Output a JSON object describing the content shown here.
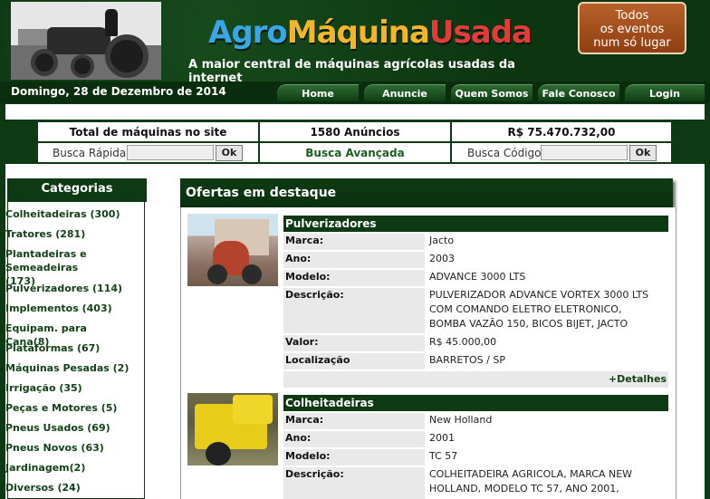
{
  "header": {
    "logo_part1": "Agro",
    "logo_part2": "Máquina",
    "logo_part3": "Usada",
    "tagline": "A maior central de máquinas agrícolas usadas da internet",
    "promo_line1": "Todos",
    "promo_line2": "os eventos",
    "promo_line3": "num só lugar"
  },
  "nav": {
    "date": "Domingo, 28 de Dezembro de 2014",
    "tabs": [
      "Home",
      "Anuncie",
      "Quem Somos",
      "Fale Conosco",
      "Login"
    ]
  },
  "stats": {
    "total_label": "Total de máquinas no site",
    "ads_count": "1580 Anúncios",
    "total_value": "R$ 75.470.732,00"
  },
  "search": {
    "quick_label": "Busca Rápida",
    "quick_value": "",
    "ok1": "Ok",
    "advanced_label": "Busca Avançada",
    "code_label": "Busca Código",
    "code_value": "",
    "ok2": "Ok"
  },
  "sidebar": {
    "title": "Categorias",
    "items": [
      "Colheitadeiras (300)",
      "Tratores (281)",
      "Plantadeiras e Semeadeiras (173)",
      "Pulverizadores (114)",
      "Implementos (403)",
      "Equipam. para Cana(8)",
      "Plataformas (67)",
      "Máquinas Pesadas (2)",
      "Irrigação (35)",
      "Peças e Motores (5)",
      "Pneus Usados (69)",
      "Pneus Novos (63)",
      "Jardinagem(2)",
      "Diversos (24)"
    ]
  },
  "offers": {
    "title": "Ofertas em destaque",
    "labels": {
      "marca": "Marca:",
      "ano": "Ano:",
      "modelo": "Modelo:",
      "descricao": "Descrição:",
      "valor": "Valor:",
      "localizacao": "Localização"
    },
    "details_link": "+Detalhes",
    "items": [
      {
        "category": "Pulverizadores",
        "marca": "Jacto",
        "ano": "2003",
        "modelo": "ADVANCE 3000 LTS",
        "descricao_l1": "PULVERIZADOR ADVANCE VORTEX 3000 LTS",
        "descricao_l2": "COM COMANDO ELETRO ELETRONICO,",
        "descricao_l3": "BOMBA VAZÃO 150, BICOS BIJET, JACTO",
        "valor": "R$ 45.000,00",
        "localizacao": "BARRETOS / SP"
      },
      {
        "category": "Colheitadeiras",
        "marca": "New Holland",
        "ano": "2001",
        "modelo": "TC 57",
        "descricao_l1": "COLHEITADEIRA AGRICOLA, MARCA NEW",
        "descricao_l2": "HOLLAND, MODELO TC 57, ANO 2001,"
      }
    ]
  }
}
